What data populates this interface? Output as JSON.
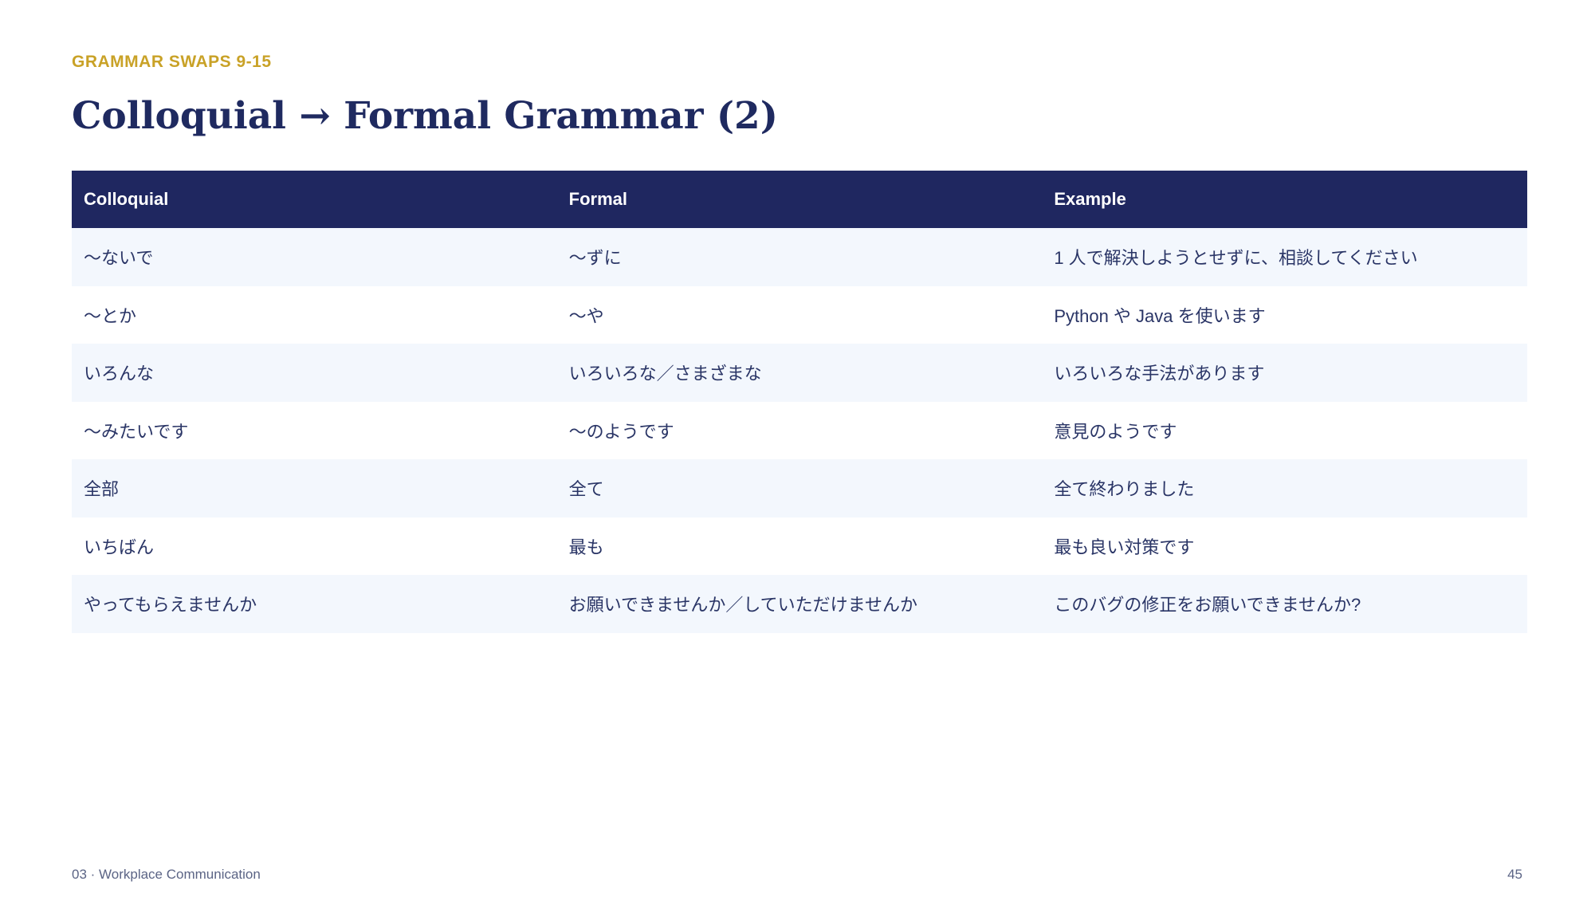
{
  "eyebrow": "GRAMMAR SWAPS 9-15",
  "title": "Colloquial → Formal Grammar (2)",
  "table": {
    "headers": [
      "Colloquial",
      "Formal",
      "Example"
    ],
    "rows": [
      [
        "～ないで",
        "～ずに",
        "1 人で解決しようとせずに、相談してください"
      ],
      [
        "～とか",
        "～や",
        "Python や Java を使います"
      ],
      [
        "いろんな",
        "いろいろな／さまざまな",
        "いろいろな手法があります"
      ],
      [
        "～みたいです",
        "～のようです",
        "意見のようです"
      ],
      [
        "全部",
        "全て",
        "全て終わりました"
      ],
      [
        "いちばん",
        "最も",
        "最も良い対策です"
      ],
      [
        "やってもらえませんか",
        "お願いできませんか／していただけませんか",
        "このバグの修正をお願いできませんか?"
      ]
    ]
  },
  "footer": {
    "section": "03 · Workplace Communication",
    "page_number": "45"
  },
  "colors": {
    "accent": "#c9a227",
    "header_bg": "#1f2760",
    "title": "#1f2a60",
    "row_stripe": "#f3f7fd"
  }
}
